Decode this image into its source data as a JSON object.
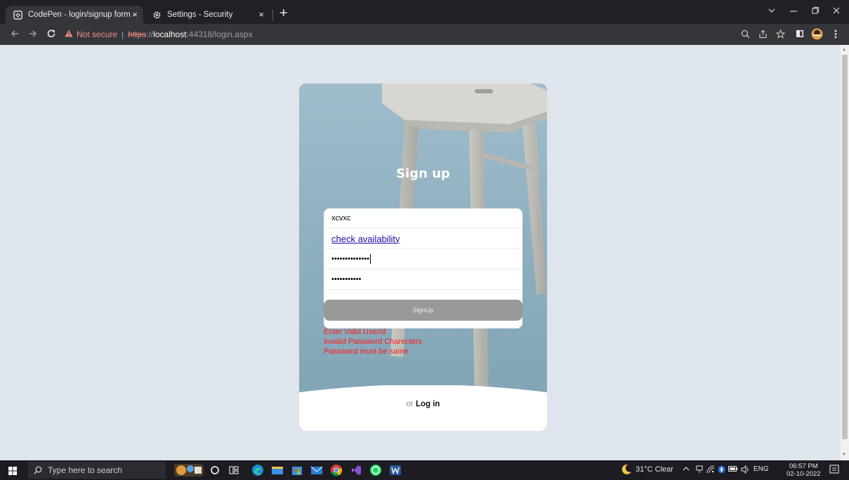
{
  "browser": {
    "tabs": [
      {
        "title": "CodePen - login/signup form ani",
        "close": "×"
      },
      {
        "title": "Settings - Security",
        "close": "×"
      }
    ],
    "new_tab": "+",
    "url": {
      "warning": "Not secure",
      "separator": "|",
      "scheme": "https",
      "rest_scheme": "://",
      "host": "localhost",
      "path": ":44318/login.aspx"
    }
  },
  "page": {
    "heading": "Sign up",
    "form": {
      "userid_value": "xcvxc",
      "check_link": "check availability",
      "password_value": "••••••••••••••",
      "confirm_value": "•••••••••••",
      "signup_button": "SignUp"
    },
    "errors": [
      "Enter Valid UserId",
      "Invalid Password Charecters",
      "Password must be same"
    ],
    "footer": {
      "or_text": "or",
      "login_link": "Log in"
    }
  },
  "taskbar": {
    "search_placeholder": "Type here to search",
    "weather": "31°C  Clear",
    "lang": "ENG",
    "time": "06:57 PM",
    "date": "02-10-2022"
  },
  "colors": {
    "error": "#ff1a1a",
    "signup_button": "#999999",
    "page_background": "#dfe5ec",
    "card_photo": "#8fb0c1"
  }
}
